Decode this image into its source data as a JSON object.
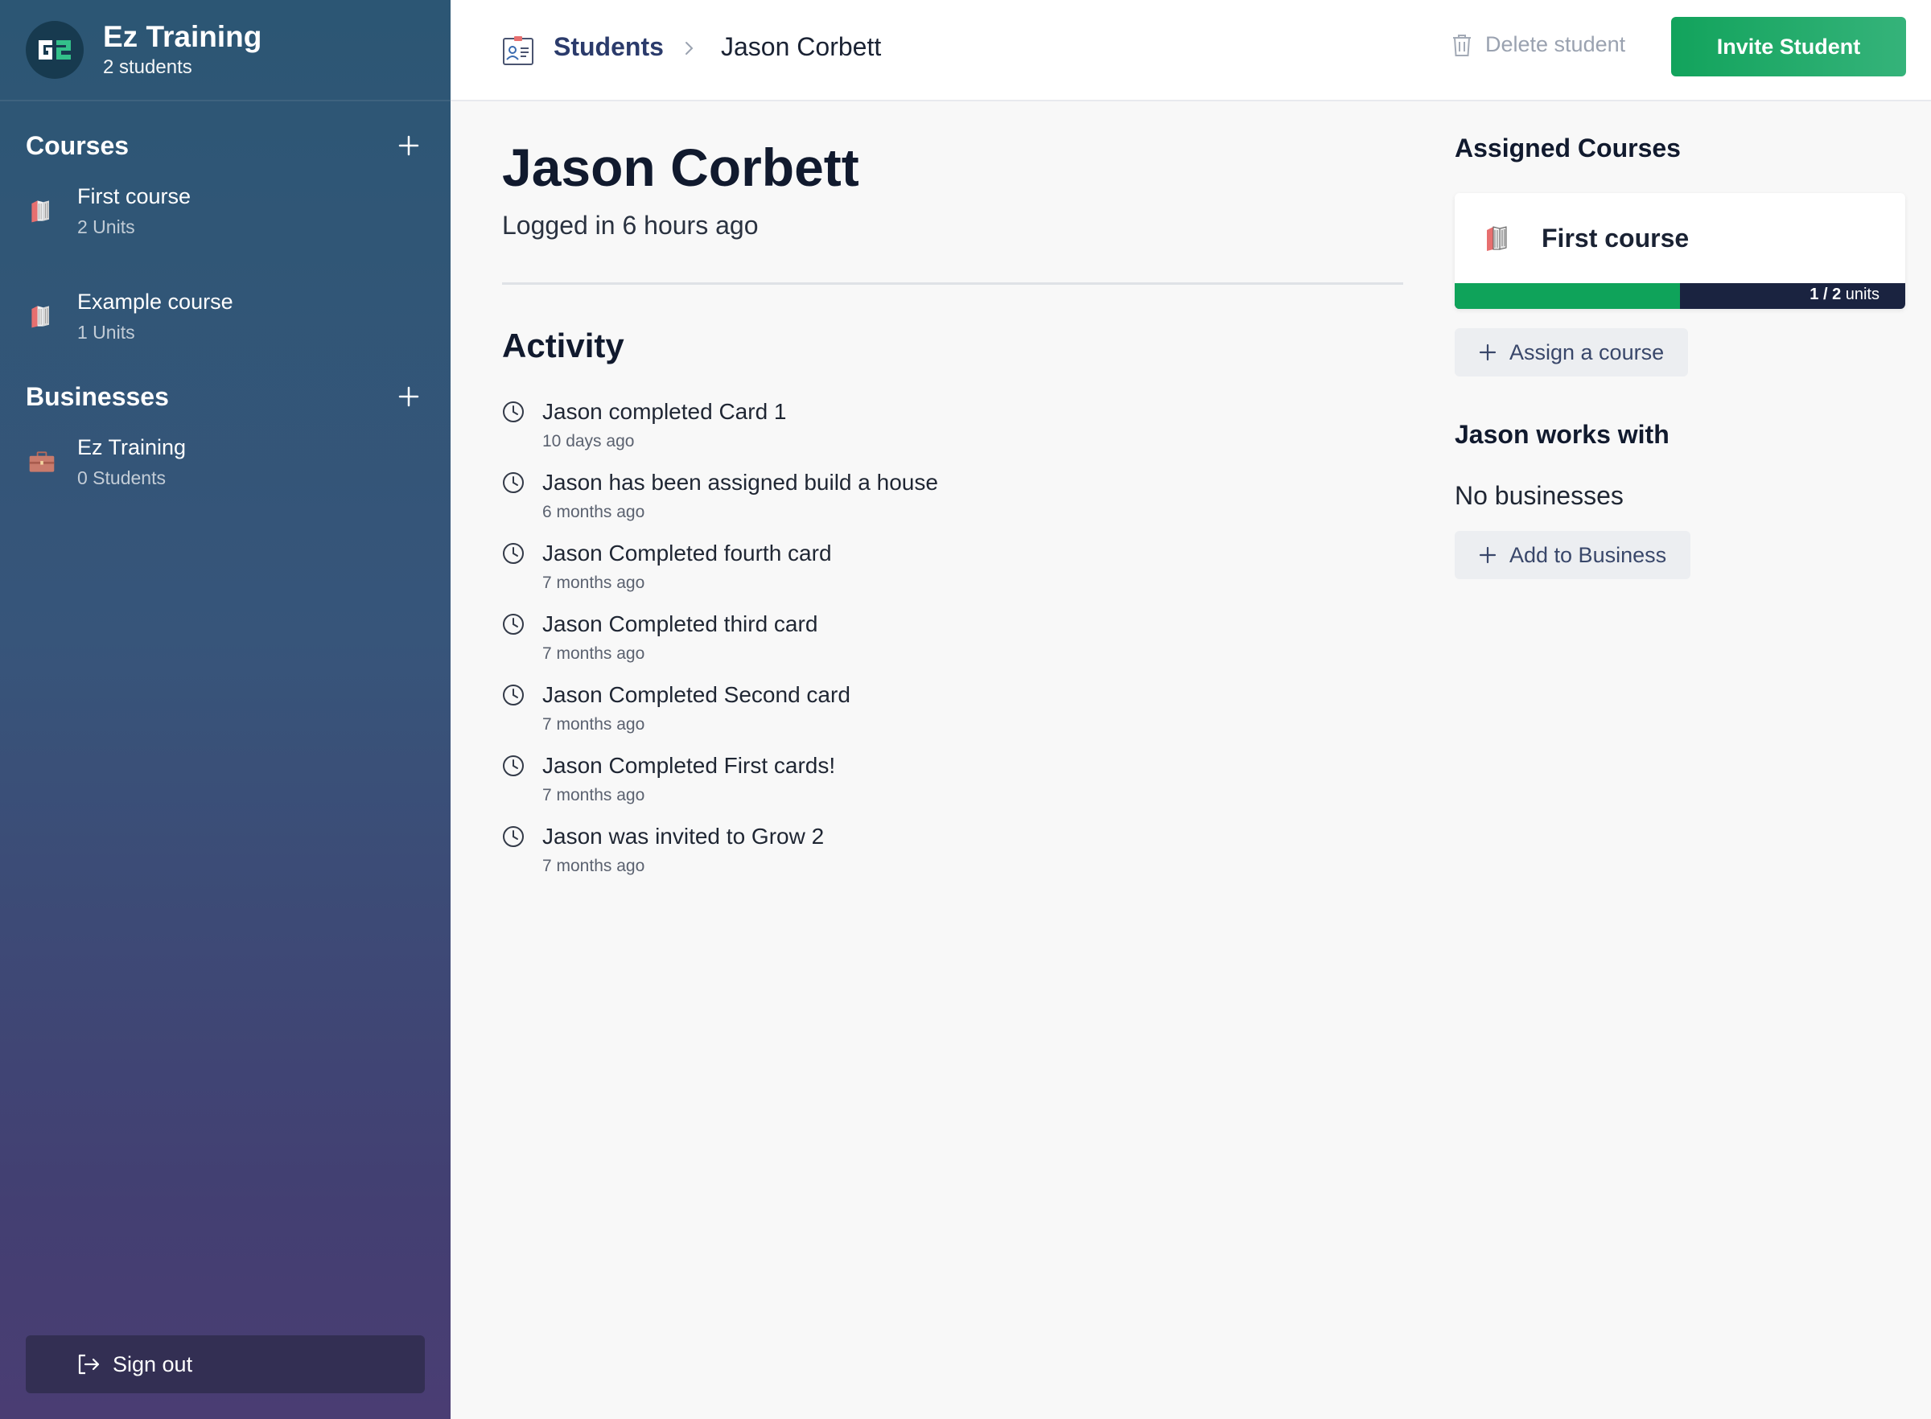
{
  "sidebar": {
    "org_name": "Ez Training",
    "org_sub": "2 students",
    "courses_title": "Courses",
    "courses": [
      {
        "title": "First course",
        "sub": "2 Units"
      },
      {
        "title": "Example course",
        "sub": "1 Units"
      }
    ],
    "businesses_title": "Businesses",
    "businesses": [
      {
        "title": "Ez Training",
        "sub": "0 Students"
      }
    ],
    "signout_label": "Sign out"
  },
  "topbar": {
    "crumb_students": "Students",
    "crumb_current": "Jason Corbett",
    "delete_label": "Delete student",
    "invite_label": "Invite Student"
  },
  "main": {
    "student_name": "Jason Corbett",
    "last_login": "Logged in 6 hours ago",
    "activity_title": "Activity",
    "activity": [
      {
        "text": "Jason completed Card 1",
        "time": "10 days ago"
      },
      {
        "text": "Jason has been assigned build a house",
        "time": "6 months ago"
      },
      {
        "text": "Jason Completed fourth card",
        "time": "7 months ago"
      },
      {
        "text": "Jason Completed third card",
        "time": "7 months ago"
      },
      {
        "text": "Jason Completed Second card",
        "time": "7 months ago"
      },
      {
        "text": "Jason Completed First cards!",
        "time": "7 months ago"
      },
      {
        "text": "Jason was invited to Grow 2",
        "time": "7 months ago"
      }
    ]
  },
  "right": {
    "assigned_title": "Assigned Courses",
    "assigned_course": {
      "name": "First course",
      "progress_done": "1",
      "progress_sep": " / ",
      "progress_total": "2",
      "progress_unit": " units",
      "progress_fraction": 0.5
    },
    "assign_label": "Assign a course",
    "works_with_title": "Jason works with",
    "no_businesses": "No businesses",
    "add_business_label": "Add to Business"
  },
  "colors": {
    "accent_green": "#12a35c",
    "sidebar_top": "#2c5674",
    "sidebar_bottom": "#4a3d73",
    "progress_bg": "#1a2340"
  }
}
